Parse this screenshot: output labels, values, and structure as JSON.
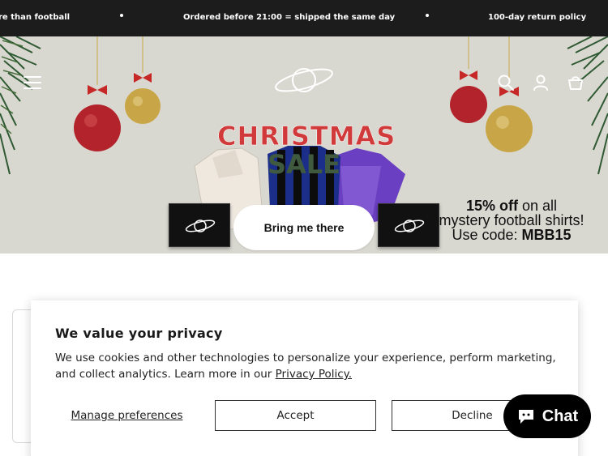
{
  "announcement": {
    "messages": [
      "re than football",
      "Ordered before 21:00 = shipped the same day",
      "100-day return policy"
    ]
  },
  "hero": {
    "title_line1": "CHRISTMAS",
    "title_line2": "SALE",
    "promo_bold": "15% off",
    "promo_rest": " on all",
    "promo_line2": "mystery football shirts!",
    "promo_line3_prefix": "Use code: ",
    "promo_code": "MBB15",
    "cta_label": "Bring me there"
  },
  "header_icons": [
    "menu-icon",
    "search-icon",
    "account-icon",
    "cart-icon"
  ],
  "cookie_banner": {
    "title": "We value your privacy",
    "text": "We use cookies and other technologies to personalize your experience, perform marketing, and collect analytics. Learn more in our ",
    "policy_link": "Privacy Policy.",
    "manage_label": "Manage preferences",
    "accept_label": "Accept",
    "decline_label": "Decline"
  },
  "chat": {
    "label": "Chat",
    "icon": "chat-bubble-icon"
  },
  "colors": {
    "announcement_bg": "#1c1c1c",
    "hero_bg": "#d9d8d0",
    "christmas_red": "#d13a3a",
    "sale_green": "#3f5a3f",
    "chat_bg": "#000000"
  }
}
